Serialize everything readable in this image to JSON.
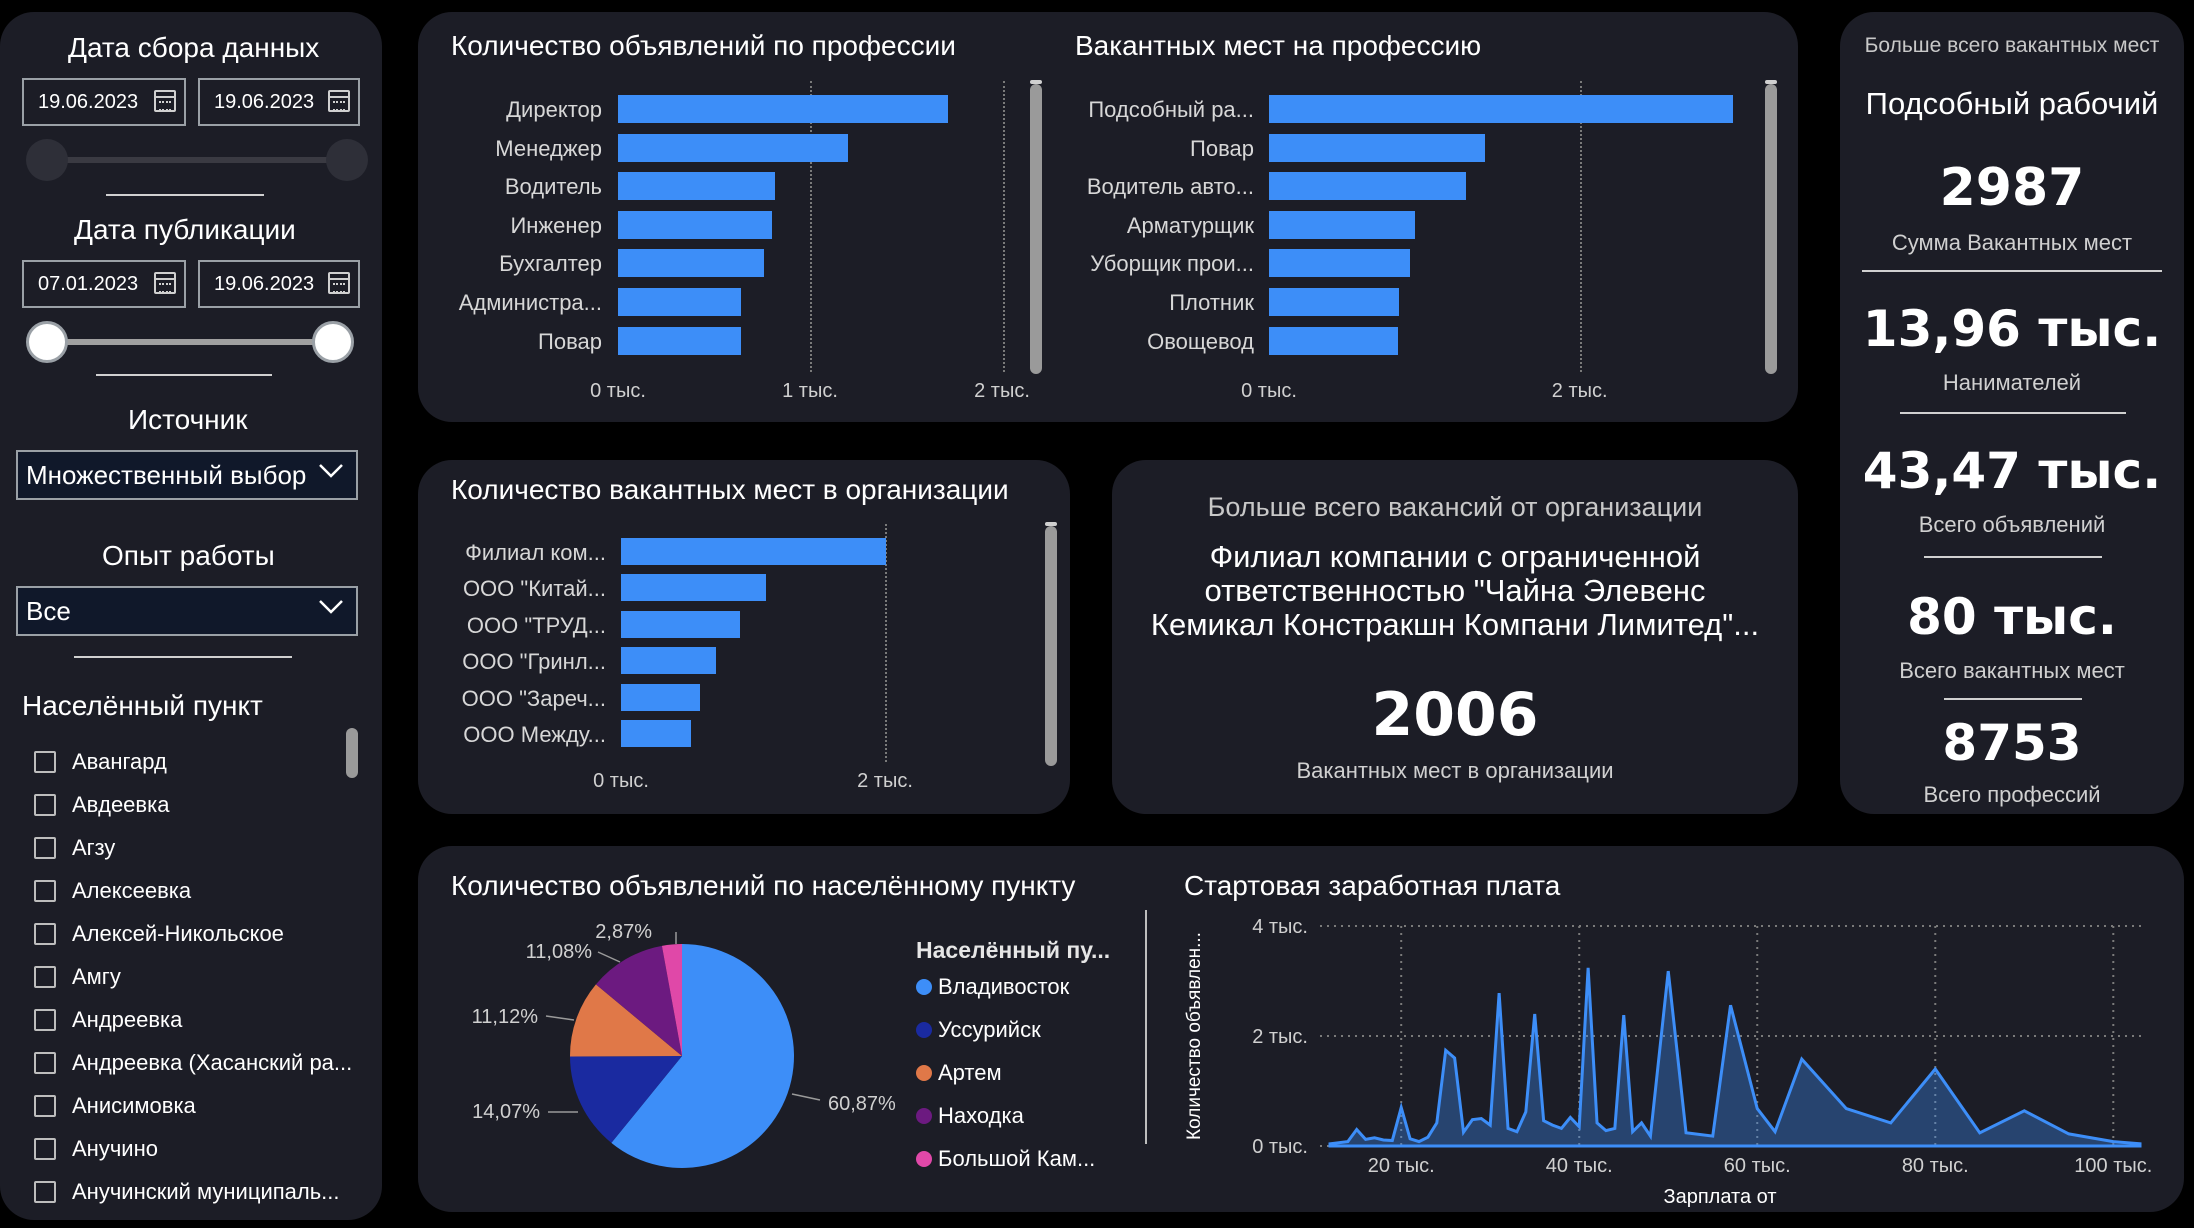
{
  "filters": {
    "collect_date": {
      "title": "Дата сбора данных",
      "from": "19.06.2023",
      "to": "19.06.2023"
    },
    "pub_date": {
      "title": "Дата публикации",
      "from": "07.01.2023",
      "to": "19.06.2023"
    },
    "source": {
      "title": "Источник",
      "value": "Множественный выбор"
    },
    "experience": {
      "title": "Опыт работы",
      "value": "Все"
    },
    "locality": {
      "title": "Населённый пункт",
      "items": [
        "Авангард",
        "Авдеевка",
        "Агзу",
        "Алексеевка",
        "Алексей-Никольское",
        "Амгу",
        "Андреевка",
        "Андреевка (Хасанский ра...",
        "Анисимовка",
        "Анучино",
        "Анучинский муниципаль..."
      ]
    }
  },
  "colors": {
    "bar": "#3d8ef8",
    "panel": "#1c1d26",
    "background": "#000000"
  },
  "icons": {
    "calendar": "calendar-icon",
    "dropdown": "chevron-down-icon",
    "checkbox": "checkbox-icon"
  },
  "ads_by_profession": {
    "title": "Количество объявлений по профессии"
  },
  "vacancies_by_profession": {
    "title": "Вакантных мест на профессию"
  },
  "vacancies_by_org": {
    "title": "Количество вакантных мест в организации"
  },
  "top_org": {
    "title": "Больше всего вакансий от организации",
    "name_lines": [
      "Филиал компании с ограниченной",
      "ответственностью \"Чайна Элевенс",
      "Кемикал Констракшн Компани Лимитед\"..."
    ],
    "value": "2006",
    "caption": "Вакантных мест в организации"
  },
  "kpis": {
    "header": "Больше всего вакантных мест",
    "top_profession": "Подсобный рабочий",
    "items": [
      {
        "value": "2987",
        "caption": "Сумма Вакантных мест"
      },
      {
        "value": "13,96 тыс.",
        "caption": "Нанимателей"
      },
      {
        "value": "43,47 тыс.",
        "caption": "Всего объявлений"
      },
      {
        "value": "80 тыс.",
        "caption": "Всего вакантных мест"
      },
      {
        "value": "8753",
        "caption": "Всего профессий"
      }
    ]
  },
  "ads_by_locality": {
    "title": "Количество объявлений по населённому пункту",
    "legend_title": "Населённый пу..."
  },
  "salary": {
    "title": "Стартовая заработная плата"
  },
  "chart_data": [
    {
      "type": "bar",
      "orientation": "horizontal",
      "title": "Количество объявлений по профессии",
      "categories": [
        "Директор",
        "Менеджер",
        "Водитель",
        "Инженер",
        "Бухгалтер",
        "Администра...",
        "Повар"
      ],
      "values": [
        1720,
        1200,
        820,
        800,
        760,
        640,
        640
      ],
      "xlim": [
        0,
        2000
      ],
      "xticks": [
        "0 тыс.",
        "1 тыс.",
        "2 тыс."
      ]
    },
    {
      "type": "bar",
      "orientation": "horizontal",
      "title": "Вакантных мест на профессию",
      "categories": [
        "Подсобный ра...",
        "Повар",
        "Водитель авто...",
        "Арматурщик",
        "Уборщик прои...",
        "Плотник",
        "Овощевод"
      ],
      "values": [
        2987,
        1390,
        1270,
        940,
        910,
        840,
        830
      ],
      "xlim": [
        0,
        3000
      ],
      "xticks": [
        "0 тыс.",
        "2 тыс."
      ]
    },
    {
      "type": "bar",
      "orientation": "horizontal",
      "title": "Количество вакантных мест в организации",
      "categories": [
        "Филиал ком...",
        "ООО \"Китай...",
        "ООО \"ТРУД...",
        "ООО \"Гринл...",
        "ООО \"Зареч...",
        "ООО Между..."
      ],
      "values": [
        2006,
        1100,
        900,
        720,
        600,
        530
      ],
      "xlim": [
        0,
        2000
      ],
      "xticks": [
        "0 тыс.",
        "2 тыс."
      ]
    },
    {
      "type": "pie",
      "title": "Количество объявлений по населённому пункту",
      "legend_title": "Населённый пу...",
      "slices": [
        {
          "name": "Владивосток",
          "value": 60.87,
          "label": "60,87%",
          "color": "#3d8ef8"
        },
        {
          "name": "Уссурийск",
          "value": 14.07,
          "label": "14,07%",
          "color": "#1a2aa0"
        },
        {
          "name": "Артем",
          "value": 11.12,
          "label": "11,12%",
          "color": "#e07848"
        },
        {
          "name": "Находка",
          "value": 11.08,
          "label": "11,08%",
          "color": "#6c1a80"
        },
        {
          "name": "Большой Кам...",
          "value": 2.87,
          "label": "2,87%",
          "color": "#e048a8"
        }
      ]
    },
    {
      "type": "area",
      "title": "Стартовая заработная плата",
      "xlabel": "Зарплата от",
      "ylabel": "Количество объявлен...",
      "xlim": [
        12000,
        103000
      ],
      "ylim": [
        0,
        4000
      ],
      "xticks": [
        "20 тыс.",
        "40 тыс.",
        "60 тыс.",
        "80 тыс.",
        "100 тыс."
      ],
      "yticks": [
        "0 тыс.",
        "2 тыс.",
        "4 тыс."
      ],
      "x": [
        12000,
        14000,
        15000,
        16000,
        17000,
        18000,
        19000,
        20000,
        21000,
        22000,
        23000,
        24000,
        25000,
        26000,
        27000,
        28000,
        29000,
        30000,
        31000,
        32000,
        33000,
        34000,
        35000,
        36000,
        37000,
        38000,
        39000,
        40000,
        41000,
        42000,
        43000,
        44000,
        45000,
        46000,
        47000,
        48000,
        50000,
        52000,
        55000,
        57000,
        60000,
        62000,
        65000,
        70000,
        75000,
        80000,
        85000,
        90000,
        95000,
        100000,
        103000
      ],
      "y": [
        40,
        80,
        300,
        120,
        150,
        110,
        100,
        700,
        130,
        80,
        160,
        420,
        1740,
        1600,
        250,
        480,
        500,
        380,
        2780,
        320,
        260,
        620,
        2400,
        460,
        380,
        320,
        520,
        350,
        3240,
        420,
        280,
        320,
        2380,
        260,
        420,
        180,
        3180,
        240,
        180,
        2560,
        680,
        260,
        1580,
        680,
        420,
        1400,
        240,
        640,
        220,
        80,
        40
      ]
    }
  ]
}
